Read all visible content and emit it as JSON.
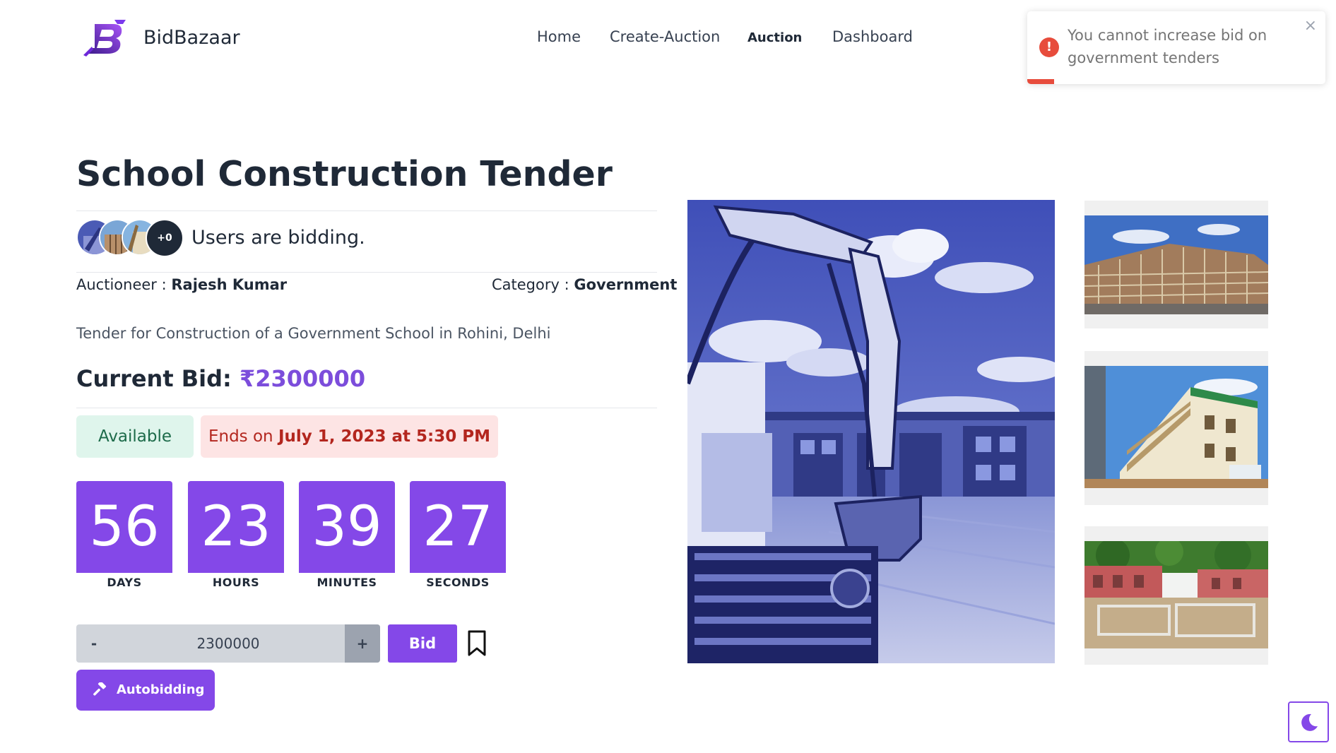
{
  "header": {
    "brand": "BidBazaar",
    "nav": [
      "Home",
      "Create-Auction",
      "Auction",
      "Dashboard"
    ],
    "active_nav": "Auction"
  },
  "toast": {
    "message": "You cannot increase bid on government tenders",
    "close_symbol": "×",
    "icon_symbol": "!",
    "type": "error",
    "progress_fraction": 0.09,
    "accent_color": "#e74c3c"
  },
  "auction": {
    "title": "School Construction Tender",
    "bidders_extra_count": "+0",
    "bidders_text": "Users are bidding.",
    "auctioneer_label": "Auctioneer : ",
    "auctioneer_name": "Rajesh Kumar",
    "category_label": "Category : ",
    "category_name": "Government",
    "description": "Tender for Construction of a Government School in Rohini, Delhi",
    "current_bid_label": "Current Bid: ",
    "current_bid_value": "₹2300000",
    "status": "Available",
    "ends_prefix": "Ends on ",
    "ends_on": "July 1, 2023 at 5:30 PM",
    "countdown": [
      {
        "value": "56",
        "label": "DAYS"
      },
      {
        "value": "23",
        "label": "HOURS"
      },
      {
        "value": "39",
        "label": "MINUTES"
      },
      {
        "value": "27",
        "label": "SECONDS"
      }
    ]
  },
  "bid_form": {
    "minus_label": "-",
    "amount_value": "2300000",
    "plus_label": "+",
    "bid_button": "Bid",
    "autobid_button": "Autobidding"
  },
  "colors": {
    "accent": "#8448e8",
    "bid_amount": "#7c4ddb",
    "available_bg": "#dff5ec",
    "ends_bg": "#fde4e4"
  },
  "icons": [
    "logo-icon",
    "error-icon",
    "close-icon",
    "bookmark-icon",
    "gavel-icon",
    "moon-icon"
  ]
}
